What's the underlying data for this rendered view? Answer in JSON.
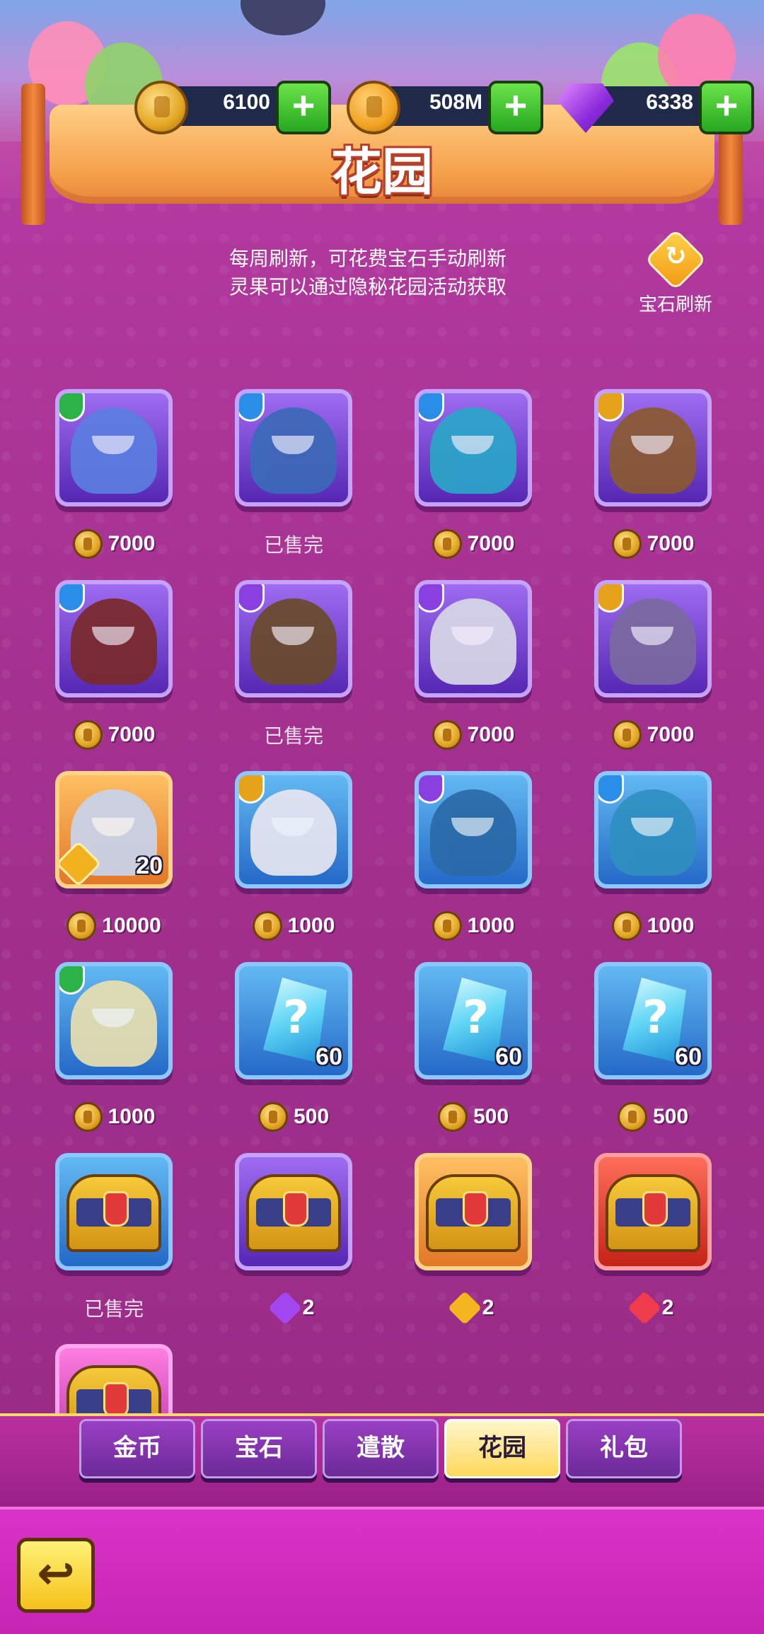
{
  "currencies": [
    {
      "name": "coin",
      "amount": "6100"
    },
    {
      "name": "piggy-coin",
      "amount": "508M"
    },
    {
      "name": "gem",
      "amount": "6338"
    }
  ],
  "title": "花园",
  "info_lines": [
    "每周刷新，可花费宝石手动刷新",
    "灵果可以通过隐秘花园活动获取"
  ],
  "refresh_label": "宝石刷新",
  "sold_out_label": "已售完",
  "items": [
    {
      "kind": "hero",
      "frame": "purple",
      "badge": "green",
      "price": "7000",
      "currency": "coin",
      "sold": false
    },
    {
      "kind": "hero",
      "frame": "purple",
      "badge": "blue",
      "price": "",
      "currency": "coin",
      "sold": true
    },
    {
      "kind": "hero",
      "frame": "purple",
      "badge": "blue",
      "price": "7000",
      "currency": "coin",
      "sold": false
    },
    {
      "kind": "hero",
      "frame": "purple",
      "badge": "gold",
      "price": "7000",
      "currency": "coin",
      "sold": false
    },
    {
      "kind": "hero",
      "frame": "purple",
      "badge": "blue",
      "price": "7000",
      "currency": "coin",
      "sold": false
    },
    {
      "kind": "hero",
      "frame": "purple",
      "badge": "purple",
      "price": "",
      "currency": "coin",
      "sold": true
    },
    {
      "kind": "hero",
      "frame": "purple",
      "badge": "purple",
      "price": "7000",
      "currency": "coin",
      "sold": false
    },
    {
      "kind": "hero",
      "frame": "purple",
      "badge": "gold",
      "price": "7000",
      "currency": "coin",
      "sold": false
    },
    {
      "kind": "hero-shard",
      "frame": "orange",
      "badge": "",
      "count": "20",
      "price": "10000",
      "currency": "coin",
      "sold": false
    },
    {
      "kind": "hero",
      "frame": "blue",
      "badge": "gold",
      "price": "1000",
      "currency": "coin",
      "sold": false
    },
    {
      "kind": "hero",
      "frame": "blue",
      "badge": "purple",
      "price": "1000",
      "currency": "coin",
      "sold": false
    },
    {
      "kind": "hero",
      "frame": "blue",
      "badge": "blue",
      "price": "1000",
      "currency": "coin",
      "sold": false
    },
    {
      "kind": "hero",
      "frame": "blue",
      "badge": "green",
      "price": "1000",
      "currency": "coin",
      "sold": false
    },
    {
      "kind": "crystal",
      "frame": "blue",
      "badge": "",
      "count": "60",
      "price": "500",
      "currency": "coin",
      "sold": false
    },
    {
      "kind": "crystal",
      "frame": "blue",
      "badge": "",
      "count": "60",
      "price": "500",
      "currency": "coin",
      "sold": false
    },
    {
      "kind": "crystal",
      "frame": "blue",
      "badge": "",
      "count": "60",
      "price": "500",
      "currency": "coin",
      "sold": false
    },
    {
      "kind": "chest",
      "frame": "blue",
      "badge": "",
      "price": "",
      "currency": "coin",
      "sold": true
    },
    {
      "kind": "chest",
      "frame": "purple",
      "badge": "",
      "price": "2",
      "currency": "puzzle-purple",
      "sold": false
    },
    {
      "kind": "chest",
      "frame": "orange",
      "badge": "",
      "price": "2",
      "currency": "puzzle-gold",
      "sold": false
    },
    {
      "kind": "chest",
      "frame": "red",
      "badge": "",
      "price": "2",
      "currency": "puzzle-red",
      "sold": false
    },
    {
      "kind": "chest",
      "frame": "pink",
      "badge": "",
      "price": "",
      "currency": "coin",
      "sold": false
    }
  ],
  "tabs": [
    {
      "label": "金币",
      "active": false
    },
    {
      "label": "宝石",
      "active": false
    },
    {
      "label": "遣散",
      "active": false
    },
    {
      "label": "花园",
      "active": true
    },
    {
      "label": "礼包",
      "active": false
    }
  ],
  "back_icon": "return-arrow-icon"
}
